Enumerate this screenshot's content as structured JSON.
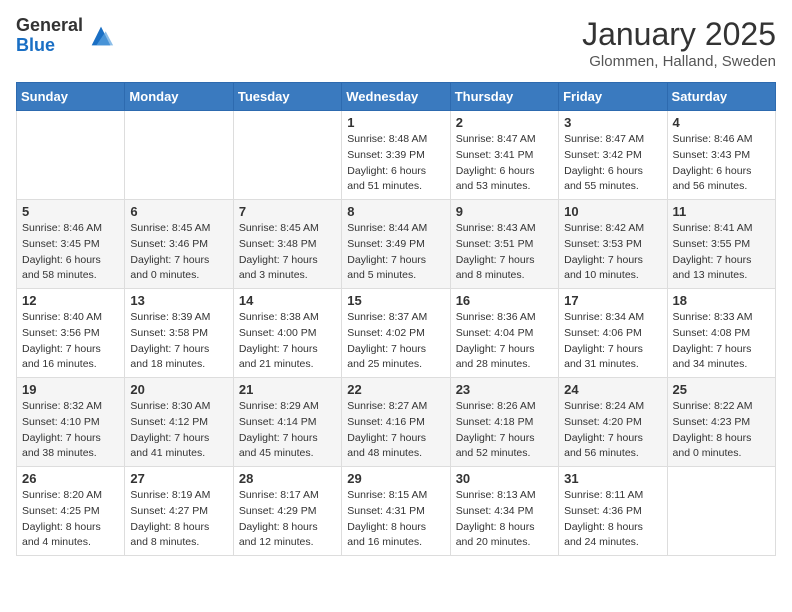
{
  "logo": {
    "general": "General",
    "blue": "Blue"
  },
  "header": {
    "month": "January 2025",
    "location": "Glommen, Halland, Sweden"
  },
  "weekdays": [
    "Sunday",
    "Monday",
    "Tuesday",
    "Wednesday",
    "Thursday",
    "Friday",
    "Saturday"
  ],
  "weeks": [
    [
      {
        "day": "",
        "sunrise": "",
        "sunset": "",
        "daylight": ""
      },
      {
        "day": "",
        "sunrise": "",
        "sunset": "",
        "daylight": ""
      },
      {
        "day": "",
        "sunrise": "",
        "sunset": "",
        "daylight": ""
      },
      {
        "day": "1",
        "sunrise": "Sunrise: 8:48 AM",
        "sunset": "Sunset: 3:39 PM",
        "daylight": "Daylight: 6 hours and 51 minutes."
      },
      {
        "day": "2",
        "sunrise": "Sunrise: 8:47 AM",
        "sunset": "Sunset: 3:41 PM",
        "daylight": "Daylight: 6 hours and 53 minutes."
      },
      {
        "day": "3",
        "sunrise": "Sunrise: 8:47 AM",
        "sunset": "Sunset: 3:42 PM",
        "daylight": "Daylight: 6 hours and 55 minutes."
      },
      {
        "day": "4",
        "sunrise": "Sunrise: 8:46 AM",
        "sunset": "Sunset: 3:43 PM",
        "daylight": "Daylight: 6 hours and 56 minutes."
      }
    ],
    [
      {
        "day": "5",
        "sunrise": "Sunrise: 8:46 AM",
        "sunset": "Sunset: 3:45 PM",
        "daylight": "Daylight: 6 hours and 58 minutes."
      },
      {
        "day": "6",
        "sunrise": "Sunrise: 8:45 AM",
        "sunset": "Sunset: 3:46 PM",
        "daylight": "Daylight: 7 hours and 0 minutes."
      },
      {
        "day": "7",
        "sunrise": "Sunrise: 8:45 AM",
        "sunset": "Sunset: 3:48 PM",
        "daylight": "Daylight: 7 hours and 3 minutes."
      },
      {
        "day": "8",
        "sunrise": "Sunrise: 8:44 AM",
        "sunset": "Sunset: 3:49 PM",
        "daylight": "Daylight: 7 hours and 5 minutes."
      },
      {
        "day": "9",
        "sunrise": "Sunrise: 8:43 AM",
        "sunset": "Sunset: 3:51 PM",
        "daylight": "Daylight: 7 hours and 8 minutes."
      },
      {
        "day": "10",
        "sunrise": "Sunrise: 8:42 AM",
        "sunset": "Sunset: 3:53 PM",
        "daylight": "Daylight: 7 hours and 10 minutes."
      },
      {
        "day": "11",
        "sunrise": "Sunrise: 8:41 AM",
        "sunset": "Sunset: 3:55 PM",
        "daylight": "Daylight: 7 hours and 13 minutes."
      }
    ],
    [
      {
        "day": "12",
        "sunrise": "Sunrise: 8:40 AM",
        "sunset": "Sunset: 3:56 PM",
        "daylight": "Daylight: 7 hours and 16 minutes."
      },
      {
        "day": "13",
        "sunrise": "Sunrise: 8:39 AM",
        "sunset": "Sunset: 3:58 PM",
        "daylight": "Daylight: 7 hours and 18 minutes."
      },
      {
        "day": "14",
        "sunrise": "Sunrise: 8:38 AM",
        "sunset": "Sunset: 4:00 PM",
        "daylight": "Daylight: 7 hours and 21 minutes."
      },
      {
        "day": "15",
        "sunrise": "Sunrise: 8:37 AM",
        "sunset": "Sunset: 4:02 PM",
        "daylight": "Daylight: 7 hours and 25 minutes."
      },
      {
        "day": "16",
        "sunrise": "Sunrise: 8:36 AM",
        "sunset": "Sunset: 4:04 PM",
        "daylight": "Daylight: 7 hours and 28 minutes."
      },
      {
        "day": "17",
        "sunrise": "Sunrise: 8:34 AM",
        "sunset": "Sunset: 4:06 PM",
        "daylight": "Daylight: 7 hours and 31 minutes."
      },
      {
        "day": "18",
        "sunrise": "Sunrise: 8:33 AM",
        "sunset": "Sunset: 4:08 PM",
        "daylight": "Daylight: 7 hours and 34 minutes."
      }
    ],
    [
      {
        "day": "19",
        "sunrise": "Sunrise: 8:32 AM",
        "sunset": "Sunset: 4:10 PM",
        "daylight": "Daylight: 7 hours and 38 minutes."
      },
      {
        "day": "20",
        "sunrise": "Sunrise: 8:30 AM",
        "sunset": "Sunset: 4:12 PM",
        "daylight": "Daylight: 7 hours and 41 minutes."
      },
      {
        "day": "21",
        "sunrise": "Sunrise: 8:29 AM",
        "sunset": "Sunset: 4:14 PM",
        "daylight": "Daylight: 7 hours and 45 minutes."
      },
      {
        "day": "22",
        "sunrise": "Sunrise: 8:27 AM",
        "sunset": "Sunset: 4:16 PM",
        "daylight": "Daylight: 7 hours and 48 minutes."
      },
      {
        "day": "23",
        "sunrise": "Sunrise: 8:26 AM",
        "sunset": "Sunset: 4:18 PM",
        "daylight": "Daylight: 7 hours and 52 minutes."
      },
      {
        "day": "24",
        "sunrise": "Sunrise: 8:24 AM",
        "sunset": "Sunset: 4:20 PM",
        "daylight": "Daylight: 7 hours and 56 minutes."
      },
      {
        "day": "25",
        "sunrise": "Sunrise: 8:22 AM",
        "sunset": "Sunset: 4:23 PM",
        "daylight": "Daylight: 8 hours and 0 minutes."
      }
    ],
    [
      {
        "day": "26",
        "sunrise": "Sunrise: 8:20 AM",
        "sunset": "Sunset: 4:25 PM",
        "daylight": "Daylight: 8 hours and 4 minutes."
      },
      {
        "day": "27",
        "sunrise": "Sunrise: 8:19 AM",
        "sunset": "Sunset: 4:27 PM",
        "daylight": "Daylight: 8 hours and 8 minutes."
      },
      {
        "day": "28",
        "sunrise": "Sunrise: 8:17 AM",
        "sunset": "Sunset: 4:29 PM",
        "daylight": "Daylight: 8 hours and 12 minutes."
      },
      {
        "day": "29",
        "sunrise": "Sunrise: 8:15 AM",
        "sunset": "Sunset: 4:31 PM",
        "daylight": "Daylight: 8 hours and 16 minutes."
      },
      {
        "day": "30",
        "sunrise": "Sunrise: 8:13 AM",
        "sunset": "Sunset: 4:34 PM",
        "daylight": "Daylight: 8 hours and 20 minutes."
      },
      {
        "day": "31",
        "sunrise": "Sunrise: 8:11 AM",
        "sunset": "Sunset: 4:36 PM",
        "daylight": "Daylight: 8 hours and 24 minutes."
      },
      {
        "day": "",
        "sunrise": "",
        "sunset": "",
        "daylight": ""
      }
    ]
  ]
}
